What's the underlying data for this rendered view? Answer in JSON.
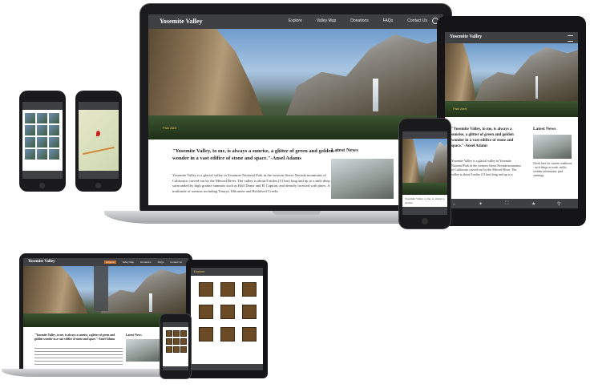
{
  "site": {
    "brand": "Yosemite Valley",
    "nav": [
      "Explore",
      "Valley Map",
      "Donations",
      "FAQs",
      "Contact Us"
    ],
    "hero_caption": "Park Alert",
    "quote": "\"Yosemite Valley, to me, is always a sunrise, a glitter of green and golden wonder in a vast edifice of stone and space.\"-Ansel Adams",
    "body": "Yosemite Valley is a glacial valley in Yosemite National Park in the western Sierra Nevada mountains of California, carved out by the Merced River. The valley is about 8 miles (13 km) long and up to a mile deep, surrounded by high granite summits such as Half Dome and El Capitan, and densely forested with pines. A multitude of streams including Tenaya, Illilouette and Bridalveil Creeks",
    "news_heading": "Latest News",
    "news_text": "Check here for current conditions - such things as roads, traffic, weather information, park warnings"
  },
  "tablet": {
    "brand": "Yosemite Valley",
    "hero_caption": "Park Alert",
    "quote": "\"Yosemite Valley, to me, is always a sunrise, a glitter of green and golden wonder in a vast edifice of stone and space.\"-Ansel Adams",
    "body": "Yosemite Valley is a glacial valley in Yosemite National Park in the western Sierra Nevada mountains of California, carved out by the Merced River. The valley is about 8 miles (13 km) long and up to a",
    "news_heading": "Latest News",
    "news_text": "Check here for current conditions - such things as roads, traffic, weather information, park warnings."
  },
  "phone_front": {
    "caption": "Yosemite Valley, to me, is always a sunrise"
  },
  "small_set": {
    "brand": "Yosemite Valley",
    "nav": [
      "Explore",
      "Valley Map",
      "Donations",
      "FAQs",
      "Contact Us"
    ],
    "quote": "\"Yosemite Valley, to me, is always a sunrise, a glitter of green and golden wonder in a vast edifice of stone and space.\"-Ansel Adams",
    "news_heading": "Latest News",
    "tablet_title": "Explore"
  }
}
